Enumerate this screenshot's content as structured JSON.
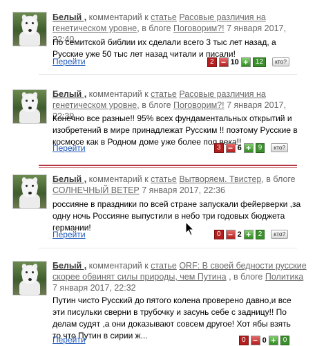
{
  "comments": [
    {
      "author": "Белый ,",
      "action": " комментарий к ",
      "article_prefix": "статье",
      "article_title": "Расовые различия на генетическом уровне",
      "blog_prefix": ", в блоге ",
      "blog": "Поговорим?!",
      "date": " 7 января 2017, 22:40",
      "text": "По семитской библии их сделали всего 3 тыс лет назад, а Русские уже 50 тыс лет назад читали и писали!",
      "goto": "Перейти",
      "rating": {
        "neg": "2",
        "score": "10",
        "pos": "12",
        "who": "кто?"
      }
    },
    {
      "author": "Белый ,",
      "action": " комментарий к ",
      "article_prefix": "статье",
      "article_title": "Расовые различия на генетическом уровне",
      "blog_prefix": ", в блоге ",
      "blog": "Поговорим?!",
      "date": " 7 января 2017, 22:39",
      "text": "Конечно все разные!! 95% всех фундаментальных открытий и изобретений в мире принадлежат Русским !! поэтому Русские в космосе как в Родном доме уже более пол века!!",
      "goto": "Перейти",
      "rating": {
        "neg": "3",
        "score": "6",
        "pos": "9",
        "who": "кто?"
      }
    },
    {
      "author": "Белый ,",
      "action": " комментарий к ",
      "article_prefix": "статье",
      "article_title": "Вытворяем. Твистер",
      "blog_prefix": ", в блоге ",
      "blog": "СОЛНЕЧНЫЙ ВЕТЕР",
      "date": " 7 января 2017, 22:36",
      "text": "россияне в праздники по всей стране запускали фейерверки ,за одну ночь Россияне выпустили в небо три годовых бюджета германии!",
      "goto": "Перейти",
      "rating": {
        "neg": "0",
        "score": "2",
        "pos": "2",
        "who": "кто?"
      }
    },
    {
      "author": "Белый ,",
      "action": " комментарий к ",
      "article_prefix": "статье",
      "article_title": "ORF: В своей бедности русские скорее обвинят силы природы, чем Путина",
      "blog_prefix": " , в блоге ",
      "blog": "Политика",
      "date": " 7 января 2017, 22:32",
      "text": "Путин чисто Русский до пятого колена проверено давно,и все эти писульки сверни в трубочку и засунь себе с задницу!! По делам судят ,а они доказывают совсем другое! Хот ябы взять то что Путин в сирии ж...",
      "goto": "Перейти",
      "rating": {
        "neg": "0",
        "score": "0",
        "pos": "0",
        "who": "кто?"
      }
    }
  ]
}
